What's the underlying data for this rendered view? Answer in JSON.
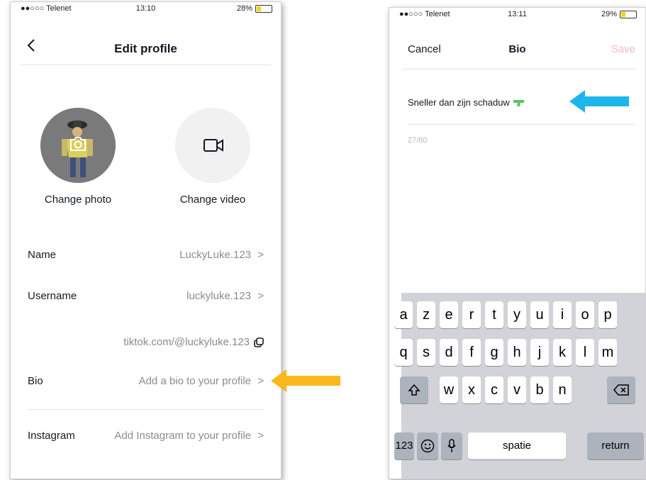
{
  "colors": {
    "accent_pink": "#fe2c55",
    "save_disabled": "#f7b9c4",
    "arrow_orange": "#fbb71c",
    "arrow_blue": "#1cb6ec",
    "battery": "#f2d500"
  },
  "left": {
    "status": {
      "carrier": "●●○○○ Telenet",
      "time": "13:10",
      "battery": "28%"
    },
    "header": {
      "title": "Edit profile",
      "back_icon": "chevron-left-icon"
    },
    "photo_caption": "Change photo",
    "video_caption": "Change video",
    "rows": [
      {
        "label": "Name",
        "value": "LuckyLuke.123",
        "chevron": ">"
      },
      {
        "label": "Username",
        "value": "luckyluke.123",
        "chevron": ">"
      },
      {
        "label": "",
        "value": "tiktok.com/@luckyluke.123",
        "icon": "copy-icon"
      },
      {
        "label": "Bio",
        "value": "Add a bio to your profile",
        "chevron": ">"
      },
      {
        "label": "Instagram",
        "value": "Add Instagram to your profile",
        "chevron": ">"
      }
    ]
  },
  "right": {
    "status": {
      "carrier": "●●○○○ Telenet",
      "time": "13:11",
      "battery": "29%"
    },
    "header": {
      "cancel": "Cancel",
      "title": "Bio",
      "save": "Save"
    },
    "bio_text": "Sneller dan zijn schaduw",
    "bio_emoji": "water-pistol-icon",
    "counter": "27/80",
    "keyboard": {
      "row1": [
        "a",
        "z",
        "e",
        "r",
        "t",
        "y",
        "u",
        "i",
        "o",
        "p"
      ],
      "row2": [
        "q",
        "s",
        "d",
        "f",
        "g",
        "h",
        "j",
        "k",
        "l",
        "m"
      ],
      "row3": [
        "w",
        "x",
        "c",
        "v",
        "b",
        "n"
      ],
      "numbers": "123",
      "space": "spatie",
      "return": "return"
    }
  }
}
